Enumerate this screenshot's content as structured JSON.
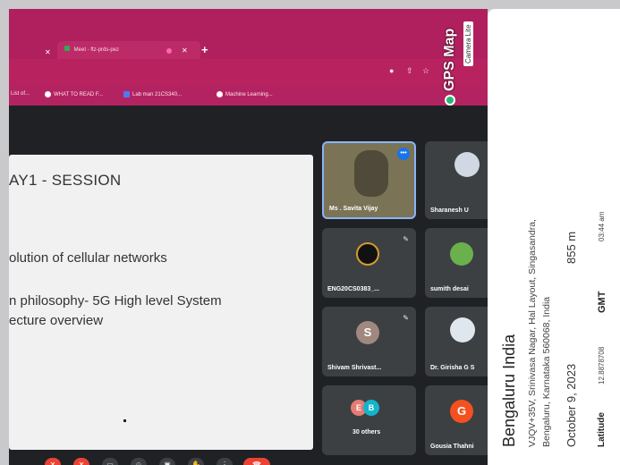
{
  "browser": {
    "active_tab": "Meet - ftz-prds-pez",
    "bookmarks": [
      "List of...",
      "WHAT TO READ F...",
      "Lab man 21CS340...",
      "Machine Learning..."
    ]
  },
  "slide": {
    "title": "AY1 - SESSION",
    "line1": "olution of cellular networks",
    "line2": "n philosophy- 5G High level System",
    "line3": "ecture overview"
  },
  "participants": [
    {
      "name": "Ms . Savita Vijay"
    },
    {
      "name": "Sharanesh U"
    },
    {
      "name": "ENG20CS0383_..."
    },
    {
      "name": "sumith desai"
    },
    {
      "name": "Shivam Shrivast...",
      "initial": "S"
    },
    {
      "name": "Dr. Girisha G S"
    },
    {
      "name": "30 others",
      "initials": [
        "E",
        "B"
      ]
    },
    {
      "name": "Gousia Thahni",
      "initial": "G"
    }
  ],
  "overlay": {
    "logo_title": "GPS Map",
    "logo_sub": "Camera Lite",
    "city": "Bengaluru India",
    "address_line1": "VJQV+35V, Srinivasa Nagar, Hal Layout, Singasandra,",
    "address_line2": "Bengaluru, Karnataka 560068, India",
    "date": "October 9, 2023",
    "altitude": "855 m",
    "latitude_label": "Latitude",
    "latitude": "12.8878708",
    "gmt_label": "GMT",
    "time": "03:44 am"
  },
  "colors": {
    "chrome": "#b0205e",
    "meet_bg": "#202124",
    "tile_bg": "#3c4043",
    "end_call": "#ea4335"
  }
}
